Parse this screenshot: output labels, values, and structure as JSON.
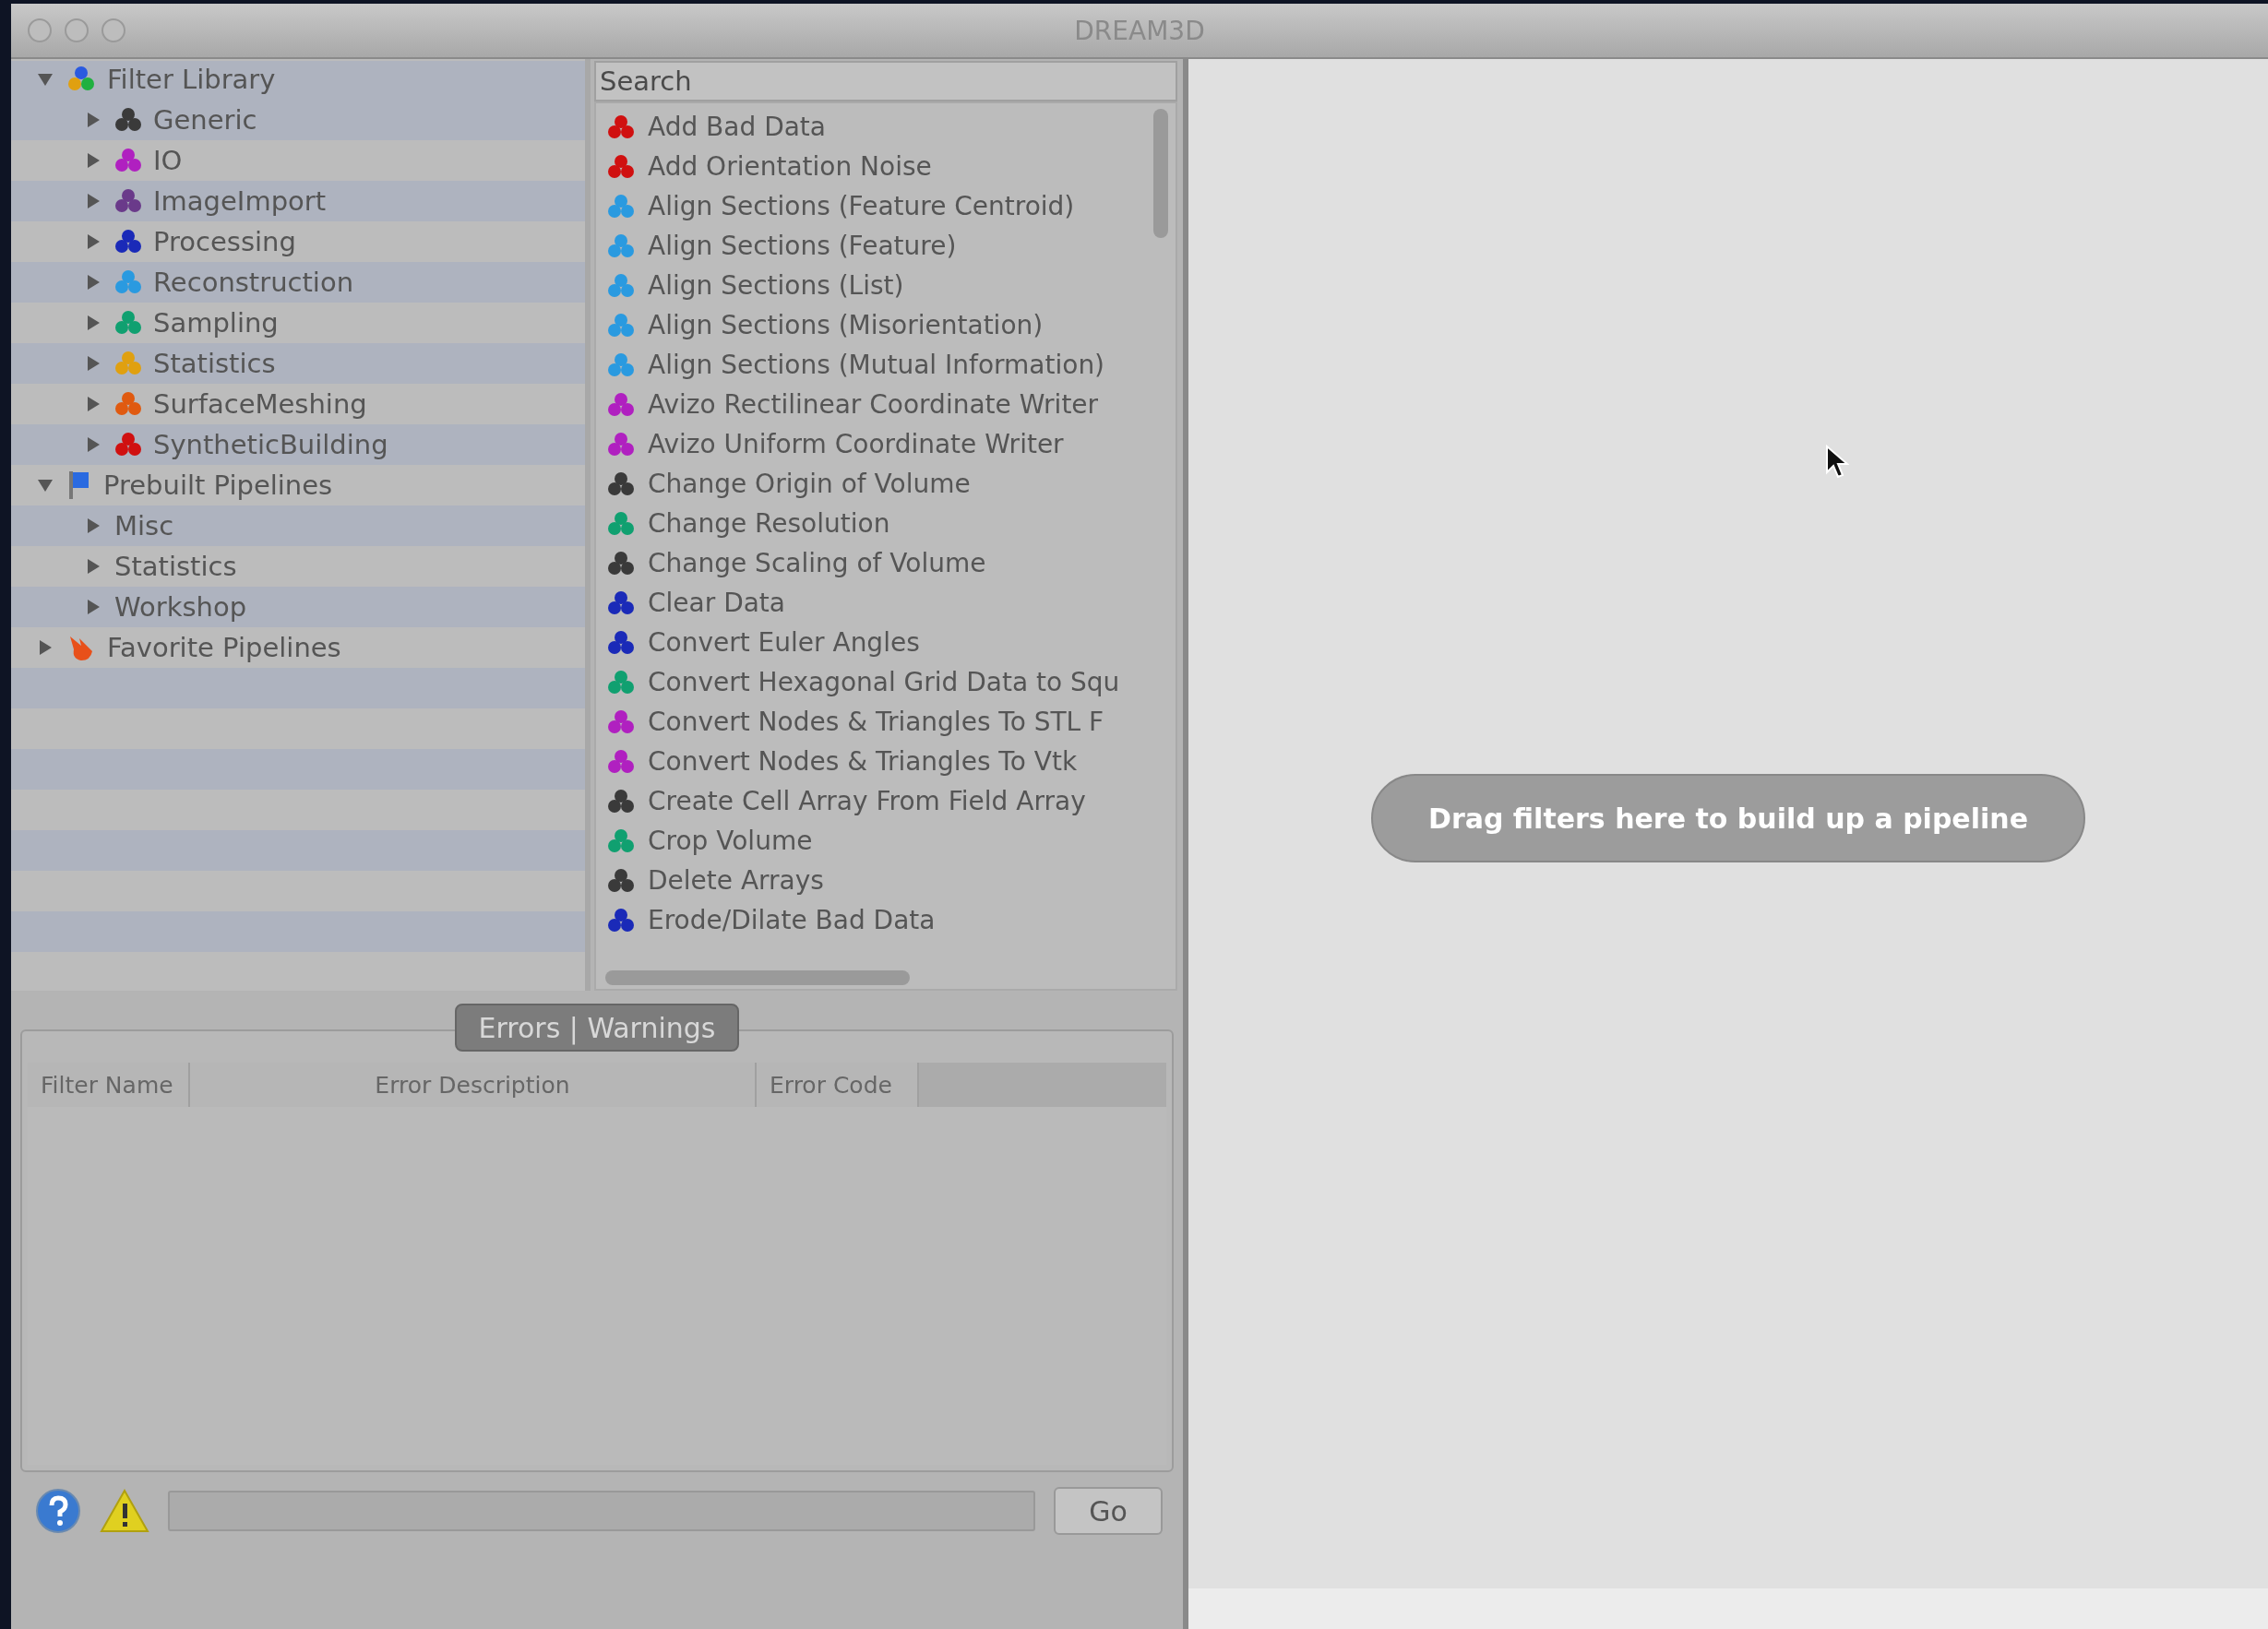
{
  "window": {
    "title": "DREAM3D"
  },
  "tree": [
    {
      "label": "Filter Library",
      "kind": "library",
      "expanded": true,
      "children": [
        {
          "label": "Generic",
          "color": "#3a3a3a",
          "expanded": false
        },
        {
          "label": "IO",
          "color": "#b020c0",
          "expanded": false
        },
        {
          "label": "ImageImport",
          "color": "#6a3a8a",
          "expanded": false
        },
        {
          "label": "Processing",
          "color": "#1a2ab8",
          "expanded": false
        },
        {
          "label": "Reconstruction",
          "color": "#2a9ae0",
          "expanded": false
        },
        {
          "label": "Sampling",
          "color": "#10a070",
          "expanded": false
        },
        {
          "label": "Statistics",
          "color": "#e0a010",
          "expanded": false
        },
        {
          "label": "SurfaceMeshing",
          "color": "#e05a10",
          "expanded": false
        },
        {
          "label": "SyntheticBuilding",
          "color": "#d01010",
          "expanded": false
        }
      ]
    },
    {
      "label": "Prebuilt Pipelines",
      "kind": "pipelines",
      "expanded": true,
      "children": [
        {
          "label": "Misc",
          "expanded": false
        },
        {
          "label": "Statistics",
          "expanded": false
        },
        {
          "label": "Workshop",
          "expanded": false
        }
      ]
    },
    {
      "label": "Favorite Pipelines",
      "kind": "favorites",
      "expanded": false
    }
  ],
  "search": {
    "placeholder": "Search"
  },
  "filters": [
    {
      "label": "Add Bad Data",
      "color": "#d01010"
    },
    {
      "label": "Add Orientation Noise",
      "color": "#d01010"
    },
    {
      "label": "Align Sections (Feature Centroid)",
      "color": "#2a9ae0"
    },
    {
      "label": "Align Sections (Feature)",
      "color": "#2a9ae0"
    },
    {
      "label": "Align Sections (List)",
      "color": "#2a9ae0"
    },
    {
      "label": "Align Sections (Misorientation)",
      "color": "#2a9ae0"
    },
    {
      "label": "Align Sections (Mutual Information)",
      "color": "#2a9ae0"
    },
    {
      "label": "Avizo Rectilinear Coordinate Writer",
      "color": "#b020c0"
    },
    {
      "label": "Avizo Uniform Coordinate Writer",
      "color": "#b020c0"
    },
    {
      "label": "Change Origin of Volume",
      "color": "#3a3a3a"
    },
    {
      "label": "Change Resolution",
      "color": "#10a070"
    },
    {
      "label": "Change Scaling of Volume",
      "color": "#3a3a3a"
    },
    {
      "label": "Clear Data",
      "color": "#1a2ab8"
    },
    {
      "label": "Convert Euler Angles",
      "color": "#1a2ab8"
    },
    {
      "label": "Convert Hexagonal Grid Data to Squ",
      "color": "#10a070"
    },
    {
      "label": "Convert Nodes & Triangles To STL F",
      "color": "#b020c0"
    },
    {
      "label": "Convert Nodes & Triangles To Vtk",
      "color": "#b020c0"
    },
    {
      "label": "Create Cell Array From Field Array",
      "color": "#3a3a3a"
    },
    {
      "label": "Crop Volume",
      "color": "#10a070"
    },
    {
      "label": "Delete Arrays",
      "color": "#3a3a3a"
    },
    {
      "label": "Erode/Dilate Bad Data",
      "color": "#1a2ab8"
    }
  ],
  "errors": {
    "tab": "Errors | Warnings",
    "columns": [
      "Filter Name",
      "Error Description",
      "Error Code"
    ]
  },
  "bottom_bar": {
    "button": "Go"
  },
  "canvas": {
    "hint": "Drag filters here to build up a pipeline"
  }
}
